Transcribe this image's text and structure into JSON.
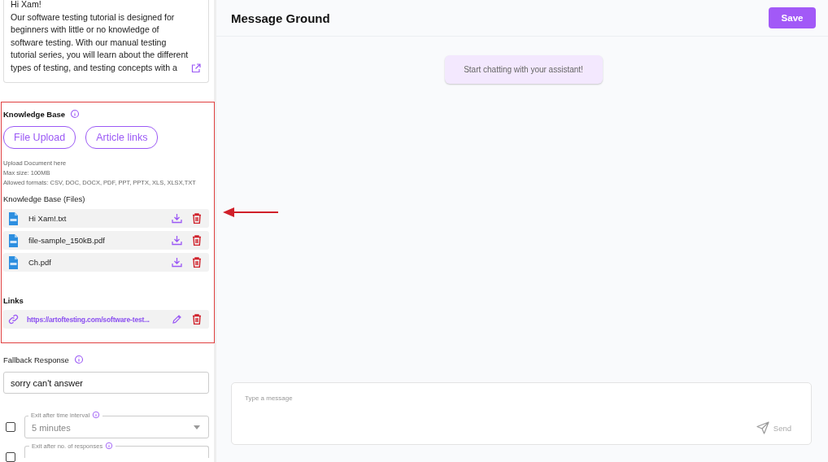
{
  "prompt_preview": {
    "text": "Hi Xam!\nOur software testing tutorial is designed for\nbeginners with little or no knowledge of\nsoftware testing. With our manual testing\ntutorial series, you will learn about the different\ntypes of testing, and testing concepts with a"
  },
  "knowledge_base": {
    "title": "Knowledge Base",
    "buttons": [
      {
        "label": "File Upload"
      },
      {
        "label": "Article links"
      }
    ],
    "upload_hint": [
      "Upload Document here",
      "Max size: 100MB",
      "Allowed formats: CSV, DOC, DOCX, PDF, PPT, PPTX, XLS, XLSX,TXT"
    ],
    "files_title": "Knowledge Base (Files)",
    "files": [
      {
        "name": "Hi Xam!.txt"
      },
      {
        "name": "file-sample_150kB.pdf"
      },
      {
        "name": "Ch.pdf"
      }
    ],
    "links_title": "Links",
    "links": [
      {
        "url": "https://artoftesting.com/software-test..."
      }
    ]
  },
  "fallback": {
    "label": "Fallback Response",
    "value": "sorry can't answer"
  },
  "exit_options": [
    {
      "label": "Exit after time interval",
      "value": "5 minutes",
      "checked": false
    },
    {
      "label": "Exit after no. of responses",
      "checked": false
    }
  ],
  "chat": {
    "title": "Message Ground",
    "save": "Save",
    "messages": [
      {
        "text": "Start chatting with your assistant!"
      }
    ],
    "input": {
      "placeholder": "Type a message"
    },
    "send": "Send"
  }
}
